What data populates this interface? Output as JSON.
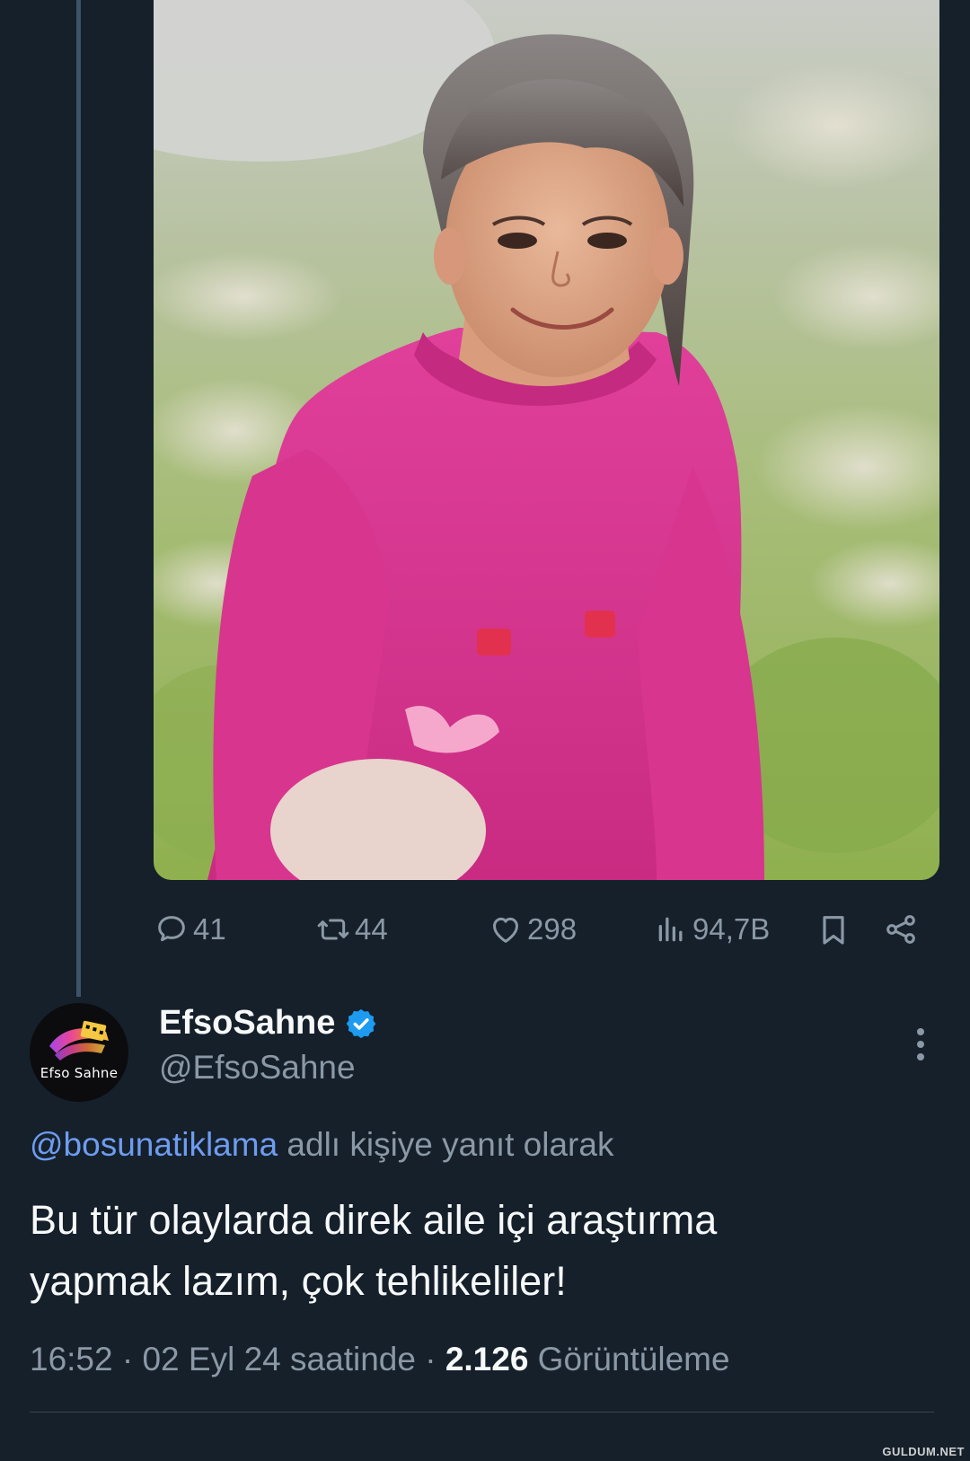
{
  "quoted_tweet": {
    "media_description": "photo",
    "stats": {
      "replies": "41",
      "retweets": "44",
      "likes": "298",
      "views": "94,7B"
    }
  },
  "tweet": {
    "display_name": "EfsoSahne",
    "handle": "@EfsoSahne",
    "avatar_label": "Efso Sahne",
    "reply_to_mention": "@bosunatiklama",
    "reply_to_suffix": " adlı kişiye yanıt olarak",
    "text_lines": [
      "Bu tür olaylarda direk aile içi araştırma",
      "yapmak lazım, çok tehlikeliler!"
    ],
    "time": "16:52",
    "separator": " · ",
    "date_text": "02 Eyl 24 saatinde",
    "views_count": "2.126",
    "views_label": " Görüntüleme"
  },
  "watermark": "GULDUM.NET",
  "colors": {
    "background": "#15202b",
    "secondary_text": "#8b98a5",
    "mention": "#6e9cf0",
    "verified": "#1d9bf0"
  }
}
